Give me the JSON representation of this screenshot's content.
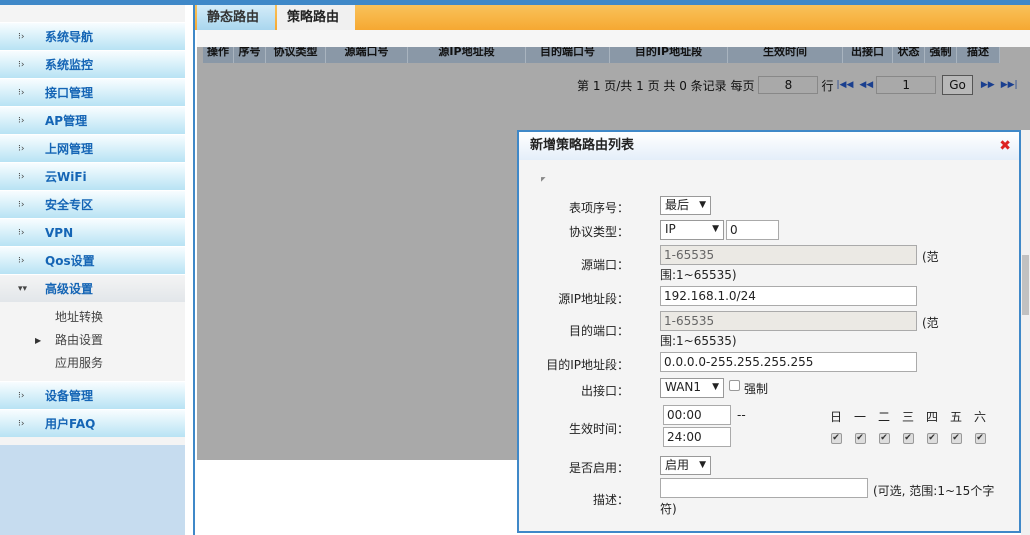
{
  "sidebar": {
    "items": [
      {
        "label": "系统导航"
      },
      {
        "label": "系统监控"
      },
      {
        "label": "接口管理"
      },
      {
        "label": "AP管理"
      },
      {
        "label": "上网管理"
      },
      {
        "label": "云WiFi"
      },
      {
        "label": "安全专区"
      },
      {
        "label": "VPN"
      },
      {
        "label": "Qos设置"
      },
      {
        "label": "高级设置",
        "expanded": true
      },
      {
        "label": "设备管理"
      },
      {
        "label": "用户FAQ"
      }
    ],
    "subitems": [
      {
        "label": "地址转换"
      },
      {
        "label": "路由设置",
        "active": true
      },
      {
        "label": "应用服务"
      }
    ]
  },
  "tabs": [
    {
      "label": "静态路由"
    },
    {
      "label": "策略路由",
      "active": true
    }
  ],
  "table": {
    "columns": [
      "操作",
      "序号",
      "协议类型",
      "源端口号",
      "源IP地址段",
      "目的端口号",
      "目的IP地址段",
      "生效时间",
      "出接口",
      "状态",
      "强制",
      "描述"
    ]
  },
  "pager": {
    "text": "第 1 页/共 1 页 共 0 条记录 每页",
    "per_page": "8",
    "rows_label": "行",
    "page": "1",
    "go": "Go"
  },
  "dialog": {
    "title": "新增策略路由列表",
    "index_label": "表项序号：",
    "index_value": "最后",
    "proto_label": "协议类型：",
    "proto_value": "IP",
    "proto_num": "0",
    "sport_label": "源端口：",
    "sport_value": "1-65535",
    "sport_note1": "(范",
    "sport_note2": "围:1~65535)",
    "sip_label": "源IP地址段：",
    "sip_value": "192.168.1.0/24",
    "dport_label": "目的端口：",
    "dport_value": "1-65535",
    "dport_note1": "(范",
    "dport_note2": "围:1~65535)",
    "dip_label": "目的IP地址段：",
    "dip_value": "0.0.0.0-255.255.255.255",
    "out_label": "出接口：",
    "out_value": "WAN1",
    "force_label": "强制",
    "force_checked": false,
    "time_label": "生效时间：",
    "time_start": "00:00",
    "time_sep": "--",
    "time_end": "24:00",
    "days": [
      {
        "label": "日",
        "checked": true
      },
      {
        "label": "一",
        "checked": true
      },
      {
        "label": "二",
        "checked": true
      },
      {
        "label": "三",
        "checked": true
      },
      {
        "label": "四",
        "checked": true
      },
      {
        "label": "五",
        "checked": true
      },
      {
        "label": "六",
        "checked": true
      }
    ],
    "enable_label": "是否启用：",
    "enable_value": "启用",
    "desc_label": "描述：",
    "desc_value": "",
    "desc_note1": "(可选, 范围:1~15个字",
    "desc_note2": "符)"
  }
}
